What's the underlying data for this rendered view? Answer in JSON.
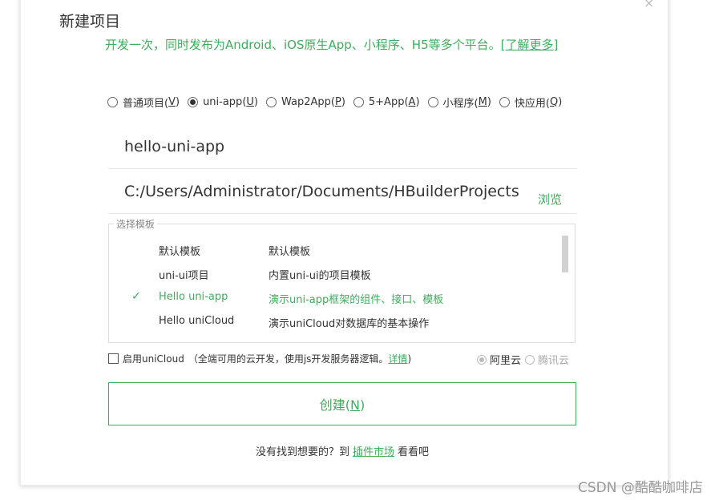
{
  "dialog": {
    "close_glyph": "×",
    "title": "新建项目",
    "subtitle": "开发一次，同时发布为Android、iOS原生App、小程序、H5等多个平台。",
    "learn_more": "[了解更多]"
  },
  "project_types": [
    {
      "label": "普通项目(",
      "key": "V",
      "tail": ")",
      "checked": false
    },
    {
      "label": "uni-app(",
      "key": "U",
      "tail": ")",
      "checked": true
    },
    {
      "label": "Wap2App(",
      "key": "P",
      "tail": ")",
      "checked": false
    },
    {
      "label": "5+App(",
      "key": "A",
      "tail": ")",
      "checked": false
    },
    {
      "label": "小程序(",
      "key": "M",
      "tail": ")",
      "checked": false
    },
    {
      "label": "快应用(",
      "key": "Q",
      "tail": ")",
      "checked": false
    }
  ],
  "form": {
    "project_name": "hello-uni-app",
    "location": "C:/Users/Administrator/Documents/HBuilderProjects",
    "browse_label": "浏览"
  },
  "templates": {
    "legend": "选择模板",
    "items": [
      {
        "name": "默认模板",
        "desc": "默认模板",
        "selected": false
      },
      {
        "name": "uni-ui项目",
        "desc": "内置uni-ui的项目模板",
        "selected": false
      },
      {
        "name": "Hello uni-app",
        "desc": "演示uni-app框架的组件、接口、模板",
        "selected": true
      },
      {
        "name": "Hello uniCloud",
        "desc": "演示uniCloud对数据库的基本操作",
        "selected": false
      }
    ],
    "check_glyph": "✓"
  },
  "unicloud": {
    "enable_label": "启用uniCloud",
    "note_prefix": "（全端可用的云开发，使用js开发服务器逻辑。",
    "details_link": "详情",
    "note_suffix": ")",
    "provider_aliyun": "阿里云",
    "provider_tencent": "腾讯云"
  },
  "create_button": {
    "label": "创建(",
    "key": "N",
    "tail": ")"
  },
  "footer": {
    "prefix": "没有找到想要的？到",
    "link": "插件市场",
    "suffix": "看看吧"
  },
  "watermark": "CSDN @酷酷咖啡店",
  "colors": {
    "accent": "#3fad5b"
  }
}
